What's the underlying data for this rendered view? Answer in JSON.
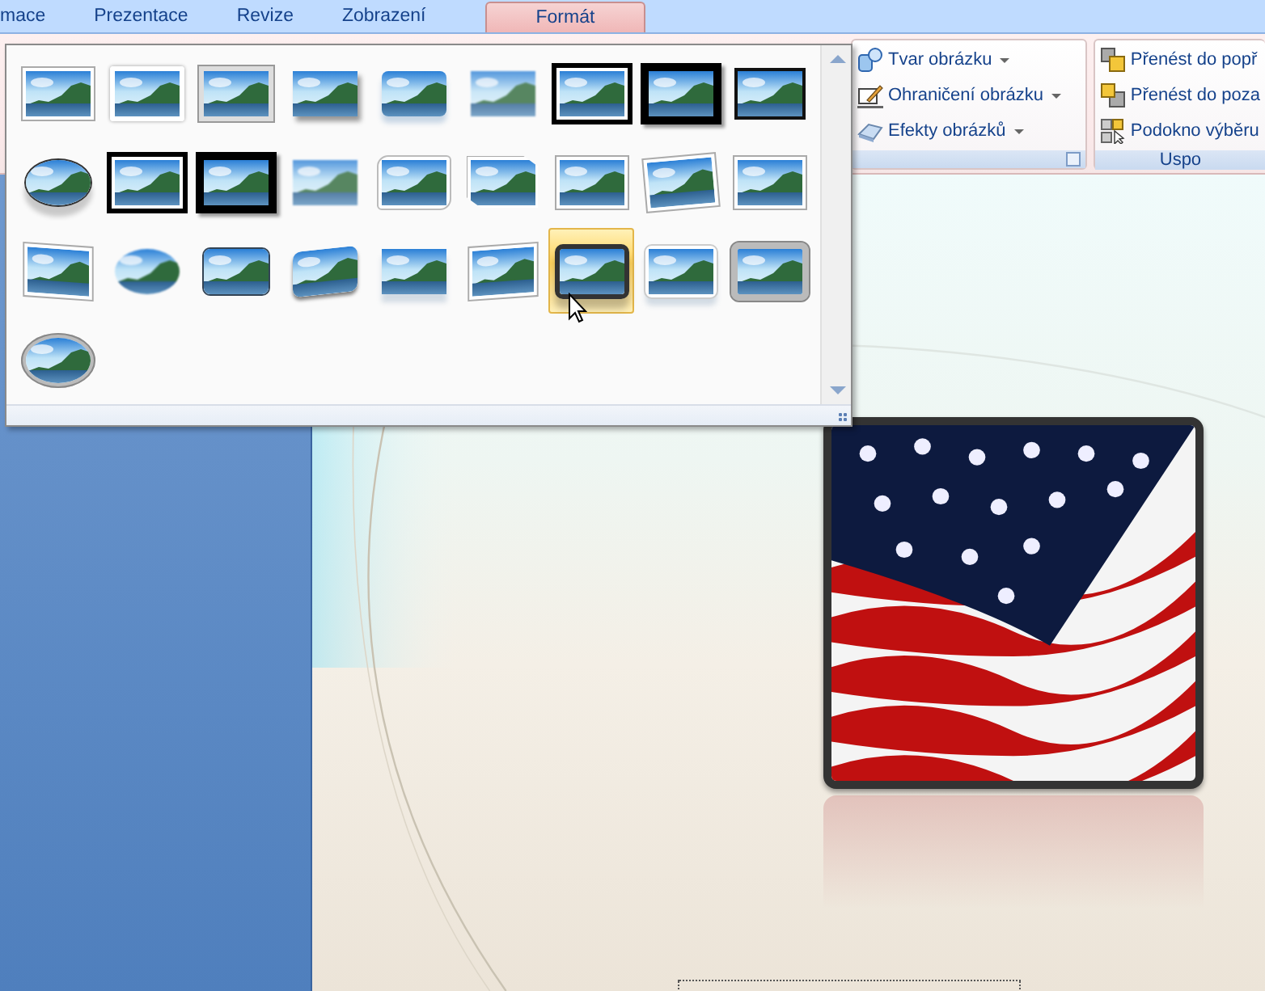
{
  "tabs": [
    {
      "label": "mace",
      "selected": false
    },
    {
      "label": "Prezentace",
      "selected": false
    },
    {
      "label": "Revize",
      "selected": false
    },
    {
      "label": "Zobrazení",
      "selected": false
    },
    {
      "label": "Formát",
      "selected": true
    }
  ],
  "ribbon": {
    "picture_group": {
      "buttons": [
        {
          "kind": "shape",
          "label": "Tvar obrázku"
        },
        {
          "kind": "border",
          "label": "Ohraničení obrázku"
        },
        {
          "kind": "effects",
          "label": "Efekty obrázků"
        }
      ]
    },
    "arrange_group": {
      "label": "Uspo",
      "buttons": [
        {
          "kind": "forward",
          "label": "Přenést do popř"
        },
        {
          "kind": "backward",
          "label": "Přenést do poza"
        },
        {
          "kind": "selection",
          "label": "Podokno výběru"
        }
      ]
    }
  },
  "gallery": {
    "styles": [
      {
        "kind": "white-frame",
        "selected": false
      },
      {
        "kind": "white-soft",
        "selected": false
      },
      {
        "kind": "grey-frame",
        "selected": false
      },
      {
        "kind": "shadow",
        "selected": false
      },
      {
        "kind": "reflected-rounded",
        "selected": false
      },
      {
        "kind": "soft-edge",
        "selected": false
      },
      {
        "kind": "double-black",
        "selected": false
      },
      {
        "kind": "thick-black",
        "selected": false
      },
      {
        "kind": "thin-black",
        "selected": false
      },
      {
        "kind": "oval",
        "selected": false
      },
      {
        "kind": "double-black",
        "selected": false
      },
      {
        "kind": "thick-black",
        "selected": false
      },
      {
        "kind": "soft-edge",
        "selected": false
      },
      {
        "kind": "rounded-white",
        "selected": false
      },
      {
        "kind": "snip",
        "selected": false
      },
      {
        "kind": "white-frame",
        "selected": false
      },
      {
        "kind": "rotated",
        "selected": false
      },
      {
        "kind": "white-frame",
        "selected": false
      },
      {
        "kind": "perspective",
        "selected": false
      },
      {
        "kind": "soft-oval",
        "selected": false
      },
      {
        "kind": "rounded-bevel",
        "selected": false
      },
      {
        "kind": "tilted",
        "selected": false
      },
      {
        "kind": "reflected",
        "selected": false
      },
      {
        "kind": "perspective-right",
        "selected": false
      },
      {
        "kind": "metal-rounded",
        "selected": true
      },
      {
        "kind": "reflected-white",
        "selected": false
      },
      {
        "kind": "grey-rounded",
        "selected": false
      },
      {
        "kind": "metal-oval",
        "selected": false
      }
    ]
  }
}
